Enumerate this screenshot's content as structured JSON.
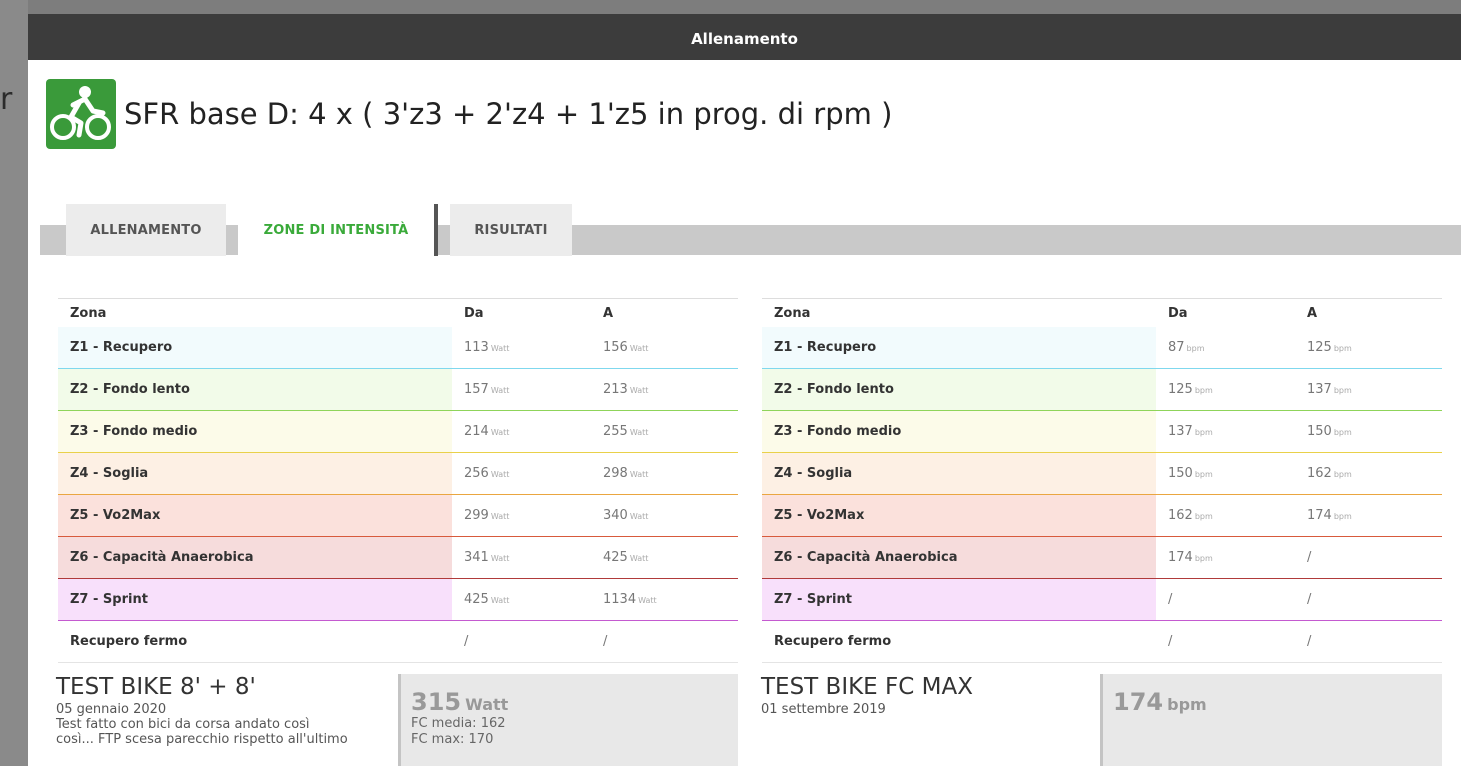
{
  "modal": {
    "header_title": "Allenamento"
  },
  "workout": {
    "icon": "cycling-icon",
    "title": "SFR base D: 4 x ( 3'z3 + 2'z4 + 1'z5 in prog. di rpm )"
  },
  "tabs": [
    {
      "label": "ALLENAMENTO",
      "active": false
    },
    {
      "label": "ZONE DI INTENSITÀ",
      "active": true
    },
    {
      "label": "RISULTATI",
      "active": false
    }
  ],
  "power_zones": {
    "headers": [
      "Zona",
      "Da",
      "A"
    ],
    "unit": "Watt",
    "rows": [
      {
        "zone": "Z1 - Recupero",
        "from": "113",
        "to": "156",
        "color": "#f2fbfd",
        "border": "#7fd8ee"
      },
      {
        "zone": "Z2 - Fondo lento",
        "from": "157",
        "to": "213",
        "color": "#f2fbe9",
        "border": "#8fd45a"
      },
      {
        "zone": "Z3 - Fondo medio",
        "from": "214",
        "to": "255",
        "color": "#fcfbe9",
        "border": "#e9d14a"
      },
      {
        "zone": "Z4 - Soglia",
        "from": "256",
        "to": "298",
        "color": "#fdf0e4",
        "border": "#eaa640"
      },
      {
        "zone": "Z5 - Vo2Max",
        "from": "299",
        "to": "340",
        "color": "#fbe1dc",
        "border": "#d85a3c"
      },
      {
        "zone": "Z6 - Capacità Anaerobica",
        "from": "341",
        "to": "425",
        "color": "#f6dcdc",
        "border": "#b03a3a"
      },
      {
        "zone": "Z7 - Sprint",
        "from": "425",
        "to": "1134",
        "color": "#f8e0fb",
        "border": "#c45ad0"
      },
      {
        "zone": "Recupero fermo",
        "from": "/",
        "to": "/",
        "color": "#ffffff",
        "border": "#e4e4e4"
      }
    ]
  },
  "hr_zones": {
    "headers": [
      "Zona",
      "Da",
      "A"
    ],
    "unit": "bpm",
    "rows": [
      {
        "zone": "Z1 - Recupero",
        "from": "87",
        "to": "125",
        "color": "#f2fbfd",
        "border": "#7fd8ee"
      },
      {
        "zone": "Z2 - Fondo lento",
        "from": "125",
        "to": "137",
        "color": "#f2fbe9",
        "border": "#8fd45a"
      },
      {
        "zone": "Z3 - Fondo medio",
        "from": "137",
        "to": "150",
        "color": "#fcfbe9",
        "border": "#e9d14a"
      },
      {
        "zone": "Z4 - Soglia",
        "from": "150",
        "to": "162",
        "color": "#fdf0e4",
        "border": "#eaa640"
      },
      {
        "zone": "Z5 - Vo2Max",
        "from": "162",
        "to": "174",
        "color": "#fbe1dc",
        "border": "#d85a3c"
      },
      {
        "zone": "Z6 - Capacità Anaerobica",
        "from": "174",
        "to": "/",
        "color": "#f6dcdc",
        "border": "#b03a3a"
      },
      {
        "zone": "Z7 - Sprint",
        "from": "/",
        "to": "/",
        "color": "#f8e0fb",
        "border": "#c45ad0"
      },
      {
        "zone": "Recupero fermo",
        "from": "/",
        "to": "/",
        "color": "#ffffff",
        "border": "#e4e4e4"
      }
    ]
  },
  "power_test": {
    "title": "TEST BIKE 8' + 8'",
    "date": "05 gennaio 2020",
    "description_line1": "Test fatto con bici da corsa andato così",
    "description_line2": "così... FTP scesa parecchio rispetto all'ultimo",
    "value": "315",
    "unit": "Watt",
    "fc_media": "FC media: 162",
    "fc_max": "FC max: 170"
  },
  "hr_test": {
    "title": "TEST BIKE FC MAX",
    "date": "01 settembre 2019",
    "value": "174",
    "unit": "bpm"
  }
}
